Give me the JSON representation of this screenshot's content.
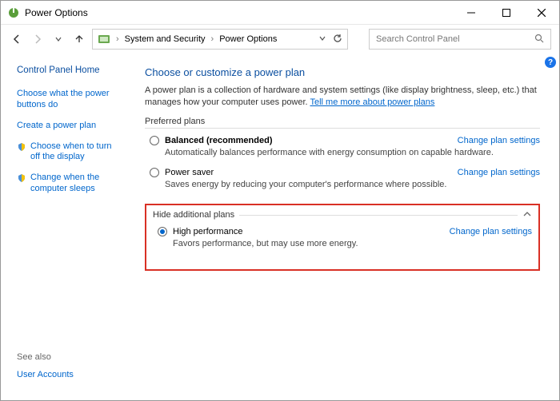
{
  "window": {
    "title": "Power Options"
  },
  "breadcrumb": {
    "root": "System and Security",
    "current": "Power Options"
  },
  "search": {
    "placeholder": "Search Control Panel"
  },
  "sidebar": {
    "home": "Control Panel Home",
    "links": [
      "Choose what the power buttons do",
      "Create a power plan",
      "Choose when to turn off the display",
      "Change when the computer sleeps"
    ],
    "seealso_label": "See also",
    "seealso_link": "User Accounts"
  },
  "main": {
    "title": "Choose or customize a power plan",
    "desc_prefix": "A power plan is a collection of hardware and system settings (like display brightness, sleep, etc.) that manages how your computer uses power. ",
    "desc_link": "Tell me more about power plans",
    "preferred_label": "Preferred plans",
    "hide_label": "Hide additional plans",
    "change_label": "Change plan settings",
    "plans": {
      "balanced": {
        "name": "Balanced (recommended)",
        "desc": "Automatically balances performance with energy consumption on capable hardware."
      },
      "saver": {
        "name": "Power saver",
        "desc": "Saves energy by reducing your computer's performance where possible."
      },
      "high": {
        "name": "High performance",
        "desc": "Favors performance, but may use more energy."
      }
    }
  }
}
